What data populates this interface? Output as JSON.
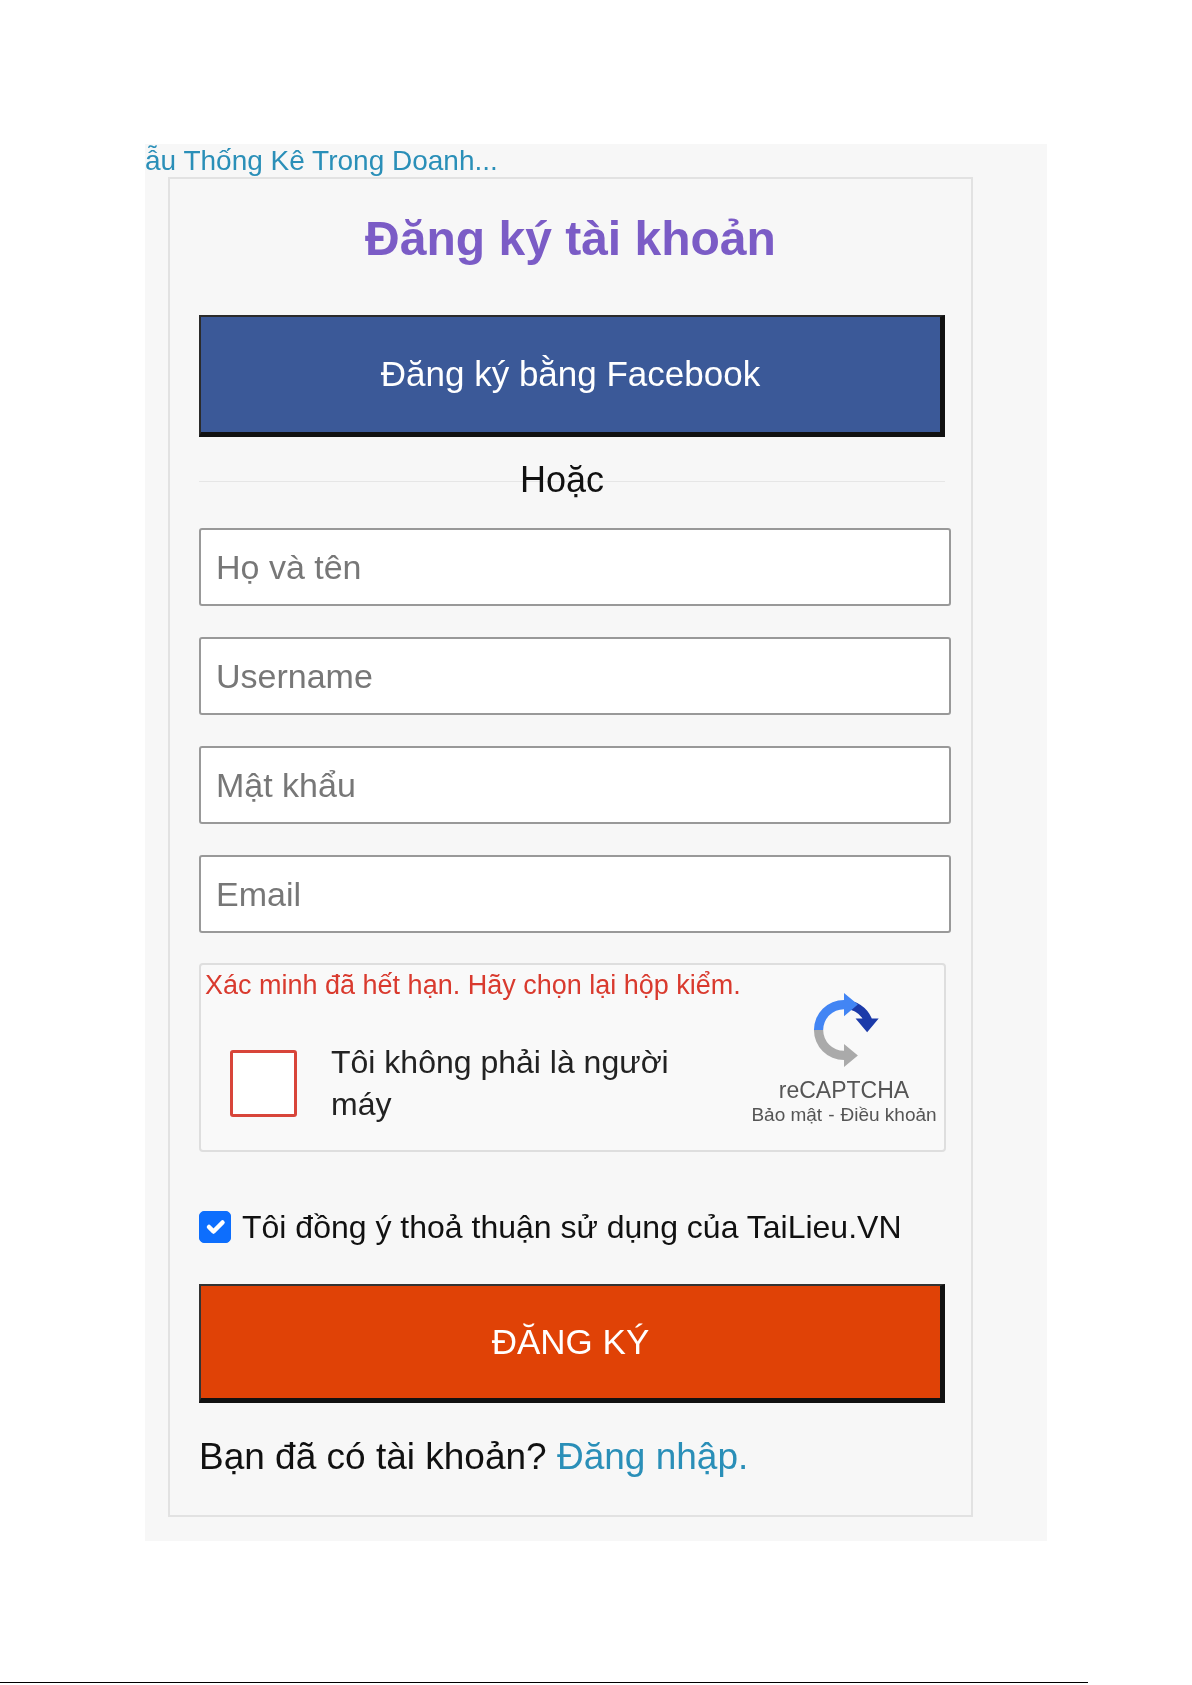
{
  "top_link": "ẫu Thống Kê Trong Doanh...",
  "title": "Đăng ký tài khoản",
  "facebook_button": "Đăng ký bằng Facebook",
  "divider_text": "Hoặc",
  "fields": [
    {
      "placeholder": "Họ và tên"
    },
    {
      "placeholder": "Username"
    },
    {
      "placeholder": "Mật khẩu"
    },
    {
      "placeholder": "Email"
    }
  ],
  "captcha": {
    "error": "Xác minh đã hết hạn. Hãy chọn lại hộp kiểm.",
    "label": "Tôi không phải là người máy",
    "checked": false,
    "brand": "reCAPTCHA",
    "privacy_link": "Bảo mật",
    "separator": "-",
    "terms_link": "Điều khoản"
  },
  "agreement": {
    "label": "Tôi đồng ý thoả thuận sử dụng của TaiLieu.VN",
    "checked": true
  },
  "submit_button": "ĐĂNG KÝ",
  "login_prompt": {
    "text": "Bạn đã có tài khoản?",
    "link": "Đăng nhập."
  }
}
